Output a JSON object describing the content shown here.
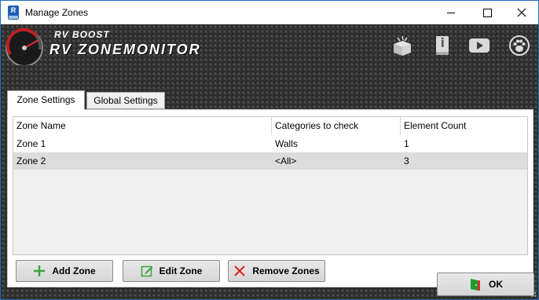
{
  "window": {
    "title": "Manage Zones"
  },
  "brand": {
    "top": "RV BOOST",
    "main": "RV ZONEMONITOR"
  },
  "header_icons": [
    "package-icon",
    "info-book-icon",
    "video-play-icon",
    "paw-icon"
  ],
  "tabs": [
    {
      "label": "Zone Settings",
      "active": true
    },
    {
      "label": "Global Settings",
      "active": false
    }
  ],
  "table": {
    "columns": [
      "Zone Name",
      "Categories to check",
      "Element Count"
    ],
    "rows": [
      {
        "name": "Zone 1",
        "categories": "Walls",
        "count": "1",
        "selected": false
      },
      {
        "name": "Zone 2",
        "categories": "<All>",
        "count": "3",
        "selected": true
      }
    ]
  },
  "buttons": {
    "add": "Add Zone",
    "edit": "Edit Zone",
    "remove": "Remove Zones",
    "ok": "OK"
  },
  "colors": {
    "add_icon": "#3aa43a",
    "edit_icon": "#3aa43a",
    "remove_icon": "#e02020",
    "ok_icon": "#1f9a2e",
    "selected_row": "#dcdcdc",
    "title_border": "#1f6fc0"
  }
}
